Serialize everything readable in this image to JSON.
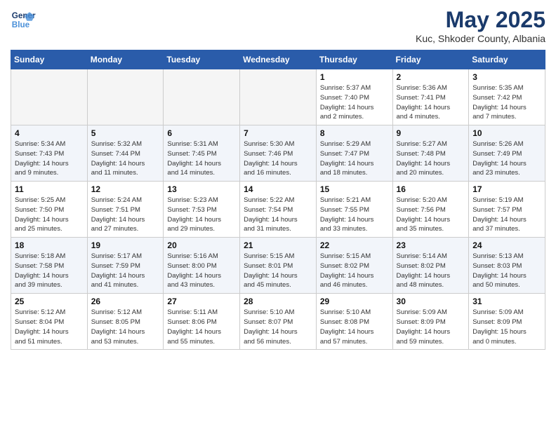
{
  "header": {
    "logo_line1": "General",
    "logo_line2": "Blue",
    "month": "May 2025",
    "location": "Kuc, Shkoder County, Albania"
  },
  "weekdays": [
    "Sunday",
    "Monday",
    "Tuesday",
    "Wednesday",
    "Thursday",
    "Friday",
    "Saturday"
  ],
  "weeks": [
    [
      {
        "day": "",
        "info": ""
      },
      {
        "day": "",
        "info": ""
      },
      {
        "day": "",
        "info": ""
      },
      {
        "day": "",
        "info": ""
      },
      {
        "day": "1",
        "info": "Sunrise: 5:37 AM\nSunset: 7:40 PM\nDaylight: 14 hours\nand 2 minutes."
      },
      {
        "day": "2",
        "info": "Sunrise: 5:36 AM\nSunset: 7:41 PM\nDaylight: 14 hours\nand 4 minutes."
      },
      {
        "day": "3",
        "info": "Sunrise: 5:35 AM\nSunset: 7:42 PM\nDaylight: 14 hours\nand 7 minutes."
      }
    ],
    [
      {
        "day": "4",
        "info": "Sunrise: 5:34 AM\nSunset: 7:43 PM\nDaylight: 14 hours\nand 9 minutes."
      },
      {
        "day": "5",
        "info": "Sunrise: 5:32 AM\nSunset: 7:44 PM\nDaylight: 14 hours\nand 11 minutes."
      },
      {
        "day": "6",
        "info": "Sunrise: 5:31 AM\nSunset: 7:45 PM\nDaylight: 14 hours\nand 14 minutes."
      },
      {
        "day": "7",
        "info": "Sunrise: 5:30 AM\nSunset: 7:46 PM\nDaylight: 14 hours\nand 16 minutes."
      },
      {
        "day": "8",
        "info": "Sunrise: 5:29 AM\nSunset: 7:47 PM\nDaylight: 14 hours\nand 18 minutes."
      },
      {
        "day": "9",
        "info": "Sunrise: 5:27 AM\nSunset: 7:48 PM\nDaylight: 14 hours\nand 20 minutes."
      },
      {
        "day": "10",
        "info": "Sunrise: 5:26 AM\nSunset: 7:49 PM\nDaylight: 14 hours\nand 23 minutes."
      }
    ],
    [
      {
        "day": "11",
        "info": "Sunrise: 5:25 AM\nSunset: 7:50 PM\nDaylight: 14 hours\nand 25 minutes."
      },
      {
        "day": "12",
        "info": "Sunrise: 5:24 AM\nSunset: 7:51 PM\nDaylight: 14 hours\nand 27 minutes."
      },
      {
        "day": "13",
        "info": "Sunrise: 5:23 AM\nSunset: 7:53 PM\nDaylight: 14 hours\nand 29 minutes."
      },
      {
        "day": "14",
        "info": "Sunrise: 5:22 AM\nSunset: 7:54 PM\nDaylight: 14 hours\nand 31 minutes."
      },
      {
        "day": "15",
        "info": "Sunrise: 5:21 AM\nSunset: 7:55 PM\nDaylight: 14 hours\nand 33 minutes."
      },
      {
        "day": "16",
        "info": "Sunrise: 5:20 AM\nSunset: 7:56 PM\nDaylight: 14 hours\nand 35 minutes."
      },
      {
        "day": "17",
        "info": "Sunrise: 5:19 AM\nSunset: 7:57 PM\nDaylight: 14 hours\nand 37 minutes."
      }
    ],
    [
      {
        "day": "18",
        "info": "Sunrise: 5:18 AM\nSunset: 7:58 PM\nDaylight: 14 hours\nand 39 minutes."
      },
      {
        "day": "19",
        "info": "Sunrise: 5:17 AM\nSunset: 7:59 PM\nDaylight: 14 hours\nand 41 minutes."
      },
      {
        "day": "20",
        "info": "Sunrise: 5:16 AM\nSunset: 8:00 PM\nDaylight: 14 hours\nand 43 minutes."
      },
      {
        "day": "21",
        "info": "Sunrise: 5:15 AM\nSunset: 8:01 PM\nDaylight: 14 hours\nand 45 minutes."
      },
      {
        "day": "22",
        "info": "Sunrise: 5:15 AM\nSunset: 8:02 PM\nDaylight: 14 hours\nand 46 minutes."
      },
      {
        "day": "23",
        "info": "Sunrise: 5:14 AM\nSunset: 8:02 PM\nDaylight: 14 hours\nand 48 minutes."
      },
      {
        "day": "24",
        "info": "Sunrise: 5:13 AM\nSunset: 8:03 PM\nDaylight: 14 hours\nand 50 minutes."
      }
    ],
    [
      {
        "day": "25",
        "info": "Sunrise: 5:12 AM\nSunset: 8:04 PM\nDaylight: 14 hours\nand 51 minutes."
      },
      {
        "day": "26",
        "info": "Sunrise: 5:12 AM\nSunset: 8:05 PM\nDaylight: 14 hours\nand 53 minutes."
      },
      {
        "day": "27",
        "info": "Sunrise: 5:11 AM\nSunset: 8:06 PM\nDaylight: 14 hours\nand 55 minutes."
      },
      {
        "day": "28",
        "info": "Sunrise: 5:10 AM\nSunset: 8:07 PM\nDaylight: 14 hours\nand 56 minutes."
      },
      {
        "day": "29",
        "info": "Sunrise: 5:10 AM\nSunset: 8:08 PM\nDaylight: 14 hours\nand 57 minutes."
      },
      {
        "day": "30",
        "info": "Sunrise: 5:09 AM\nSunset: 8:09 PM\nDaylight: 14 hours\nand 59 minutes."
      },
      {
        "day": "31",
        "info": "Sunrise: 5:09 AM\nSunset: 8:09 PM\nDaylight: 15 hours\nand 0 minutes."
      }
    ]
  ]
}
